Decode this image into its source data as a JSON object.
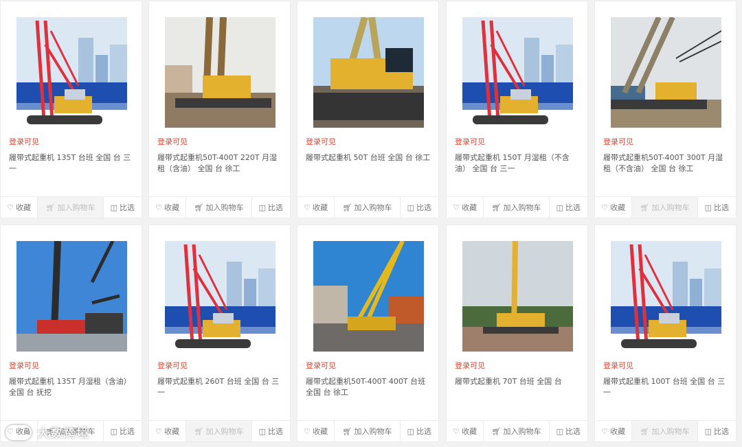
{
  "colors": {
    "login_red": "#e8402c",
    "boom_red": "#e0303c",
    "boom_yellow": "#e3b12e",
    "brand_blue": "#1e4fb0"
  },
  "icons": {
    "favorite": "heart-icon",
    "cart": "cart-icon",
    "compare": "compare-icon"
  },
  "labels": {
    "favorite": "收藏",
    "cart": "加入购物车",
    "compare": "比选"
  },
  "watermark": "大数跨境",
  "products": [
    {
      "login_text": "登录可见",
      "title": "履带式起重机 135T 台班 全国 台 三一",
      "image": "red-crane-promo",
      "cart_disabled": true
    },
    {
      "login_text": "登录可见",
      "title": "履带式起重机50T-400T 220T 月湿租（含油） 全国 台 徐工",
      "image": "lattice-crane-site",
      "cart_disabled": false
    },
    {
      "login_text": "登录可见",
      "title": "履带式起重机 50T 台班 全国 台 徐工",
      "image": "yellow-crane-closeup",
      "cart_disabled": false
    },
    {
      "login_text": "登录可见",
      "title": "履带式起重机 150T 月湿租（不含油） 全国 台 三一",
      "image": "red-crane-promo",
      "cart_disabled": false
    },
    {
      "login_text": "登录可见",
      "title": "履带式起重机50T-400T 300T 月湿租（不含油） 全国 台 徐工",
      "image": "crane-port",
      "cart_disabled": true
    },
    {
      "login_text": "登录可见",
      "title": "履带式起重机 135T 月湿租（含油） 全国 台 抚挖",
      "image": "crane-blue-sky",
      "cart_disabled": false
    },
    {
      "login_text": "登录可见",
      "title": "履带式起重机 260T 台班 全国 台 三一",
      "image": "red-crane-promo",
      "cart_disabled": true
    },
    {
      "login_text": "登录可见",
      "title": "履带式起重机50T-400T 400T 台班 全国 台 徐工",
      "image": "crane-industrial",
      "cart_disabled": false
    },
    {
      "login_text": "登录可见",
      "title": "履带式起重机 70T 台班 全国 台",
      "image": "yellow-crane-field",
      "cart_disabled": false
    },
    {
      "login_text": "登录可见",
      "title": "履带式起重机 100T 台班 全国 台 三一",
      "image": "red-crane-promo",
      "cart_disabled": true
    }
  ]
}
